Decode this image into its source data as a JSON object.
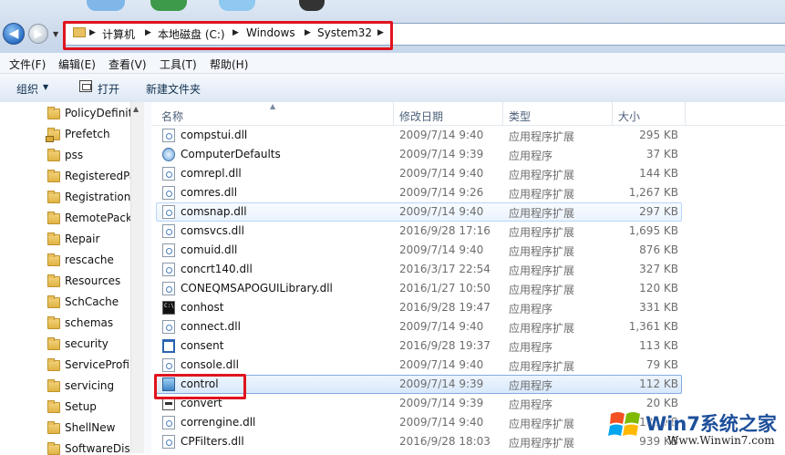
{
  "address_bar": {
    "breadcrumbs": [
      "计算机",
      "本地磁盘 (C:)",
      "Windows",
      "System32"
    ]
  },
  "menu": [
    "文件(F)",
    "编辑(E)",
    "查看(V)",
    "工具(T)",
    "帮助(H)"
  ],
  "toolbar": {
    "organize": "组织",
    "open": "打开",
    "new_folder": "新建文件夹"
  },
  "nav_tree": [
    "PolicyDefinitions",
    "Prefetch",
    "pss",
    "RegisteredPackages",
    "Registration",
    "RemotePackages",
    "Repair",
    "rescache",
    "Resources",
    "SchCache",
    "schemas",
    "security",
    "ServiceProfiles",
    "servicing",
    "Setup",
    "ShellNew",
    "SoftwareDistribution"
  ],
  "columns": {
    "name": "名称",
    "date": "修改日期",
    "type": "类型",
    "size": "大小"
  },
  "files": [
    {
      "name": "compstui.dll",
      "date": "2009/7/14 9:40",
      "type": "应用程序扩展",
      "size": "295 KB",
      "icon": "dll-icon"
    },
    {
      "name": "ComputerDefaults",
      "date": "2009/7/14 9:39",
      "type": "应用程序",
      "size": "37 KB",
      "icon": "defaults-icon"
    },
    {
      "name": "comrepl.dll",
      "date": "2009/7/14 9:40",
      "type": "应用程序扩展",
      "size": "144 KB",
      "icon": "dll-icon"
    },
    {
      "name": "comres.dll",
      "date": "2009/7/14 9:26",
      "type": "应用程序扩展",
      "size": "1,267 KB",
      "icon": "dll-icon"
    },
    {
      "name": "comsnap.dll",
      "date": "2009/7/14 9:40",
      "type": "应用程序扩展",
      "size": "297 KB",
      "icon": "dll-icon"
    },
    {
      "name": "comsvcs.dll",
      "date": "2016/9/28 17:16",
      "type": "应用程序扩展",
      "size": "1,695 KB",
      "icon": "dll-icon"
    },
    {
      "name": "comuid.dll",
      "date": "2009/7/14 9:40",
      "type": "应用程序扩展",
      "size": "876 KB",
      "icon": "dll-icon"
    },
    {
      "name": "concrt140.dll",
      "date": "2016/3/17 22:54",
      "type": "应用程序扩展",
      "size": "327 KB",
      "icon": "dll-icon"
    },
    {
      "name": "CONEQMSAPOGUILibrary.dll",
      "date": "2016/1/27 10:50",
      "type": "应用程序扩展",
      "size": "120 KB",
      "icon": "dll-icon"
    },
    {
      "name": "conhost",
      "date": "2016/9/28 19:47",
      "type": "应用程序",
      "size": "331 KB",
      "icon": "console-icon"
    },
    {
      "name": "connect.dll",
      "date": "2009/7/14 9:40",
      "type": "应用程序扩展",
      "size": "1,361 KB",
      "icon": "dll-icon"
    },
    {
      "name": "consent",
      "date": "2016/9/28 19:37",
      "type": "应用程序",
      "size": "113 KB",
      "icon": "window-icon"
    },
    {
      "name": "console.dll",
      "date": "2009/7/14 9:40",
      "type": "应用程序扩展",
      "size": "79 KB",
      "icon": "dll-icon"
    },
    {
      "name": "control",
      "date": "2009/7/14 9:39",
      "type": "应用程序",
      "size": "112 KB",
      "icon": "control-panel-icon"
    },
    {
      "name": "convert",
      "date": "2009/7/14 9:39",
      "type": "应用程序",
      "size": "20 KB",
      "icon": "convert-icon"
    },
    {
      "name": "correngine.dll",
      "date": "2009/7/14 9:40",
      "type": "应用程序扩展",
      "size": "188 KB",
      "icon": "dll-icon"
    },
    {
      "name": "CPFilters.dll",
      "date": "2016/9/28 18:03",
      "type": "应用程序扩展",
      "size": "939 KB",
      "icon": "dll-icon"
    }
  ],
  "watermark": {
    "logo": "Win7系统之家",
    "url": "Www.Winwin7.com"
  }
}
